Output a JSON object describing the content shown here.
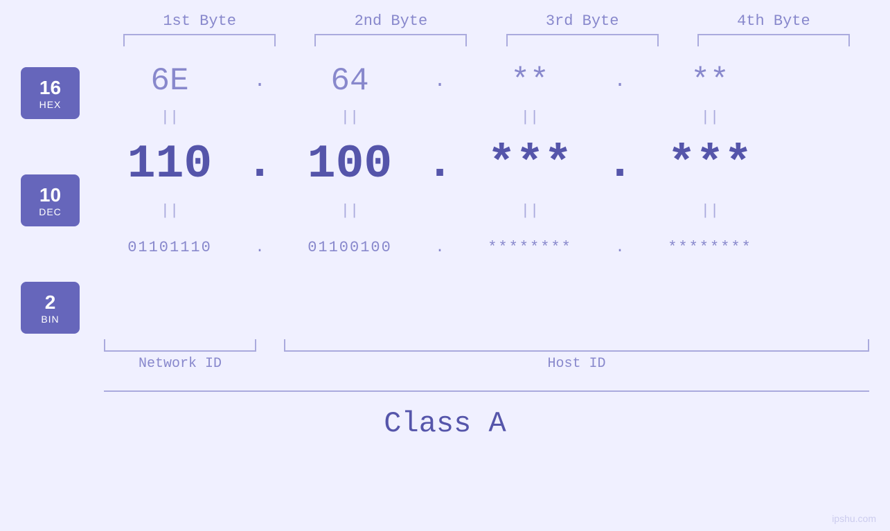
{
  "byte_headers": [
    "1st Byte",
    "2nd Byte",
    "3rd Byte",
    "4th Byte"
  ],
  "bases": [
    {
      "number": "16",
      "label": "HEX"
    },
    {
      "number": "10",
      "label": "DEC"
    },
    {
      "number": "2",
      "label": "BIN"
    }
  ],
  "hex_values": [
    "6E",
    "64",
    "**",
    "**"
  ],
  "dec_values": [
    "110",
    "100",
    "***",
    "***"
  ],
  "bin_values": [
    "01101110",
    "01100100",
    "********",
    "********"
  ],
  "separators": [
    ".",
    ".",
    ".",
    ""
  ],
  "equals_symbol": "||",
  "network_id_label": "Network ID",
  "host_id_label": "Host ID",
  "class_label": "Class A",
  "watermark": "ipshu.com"
}
